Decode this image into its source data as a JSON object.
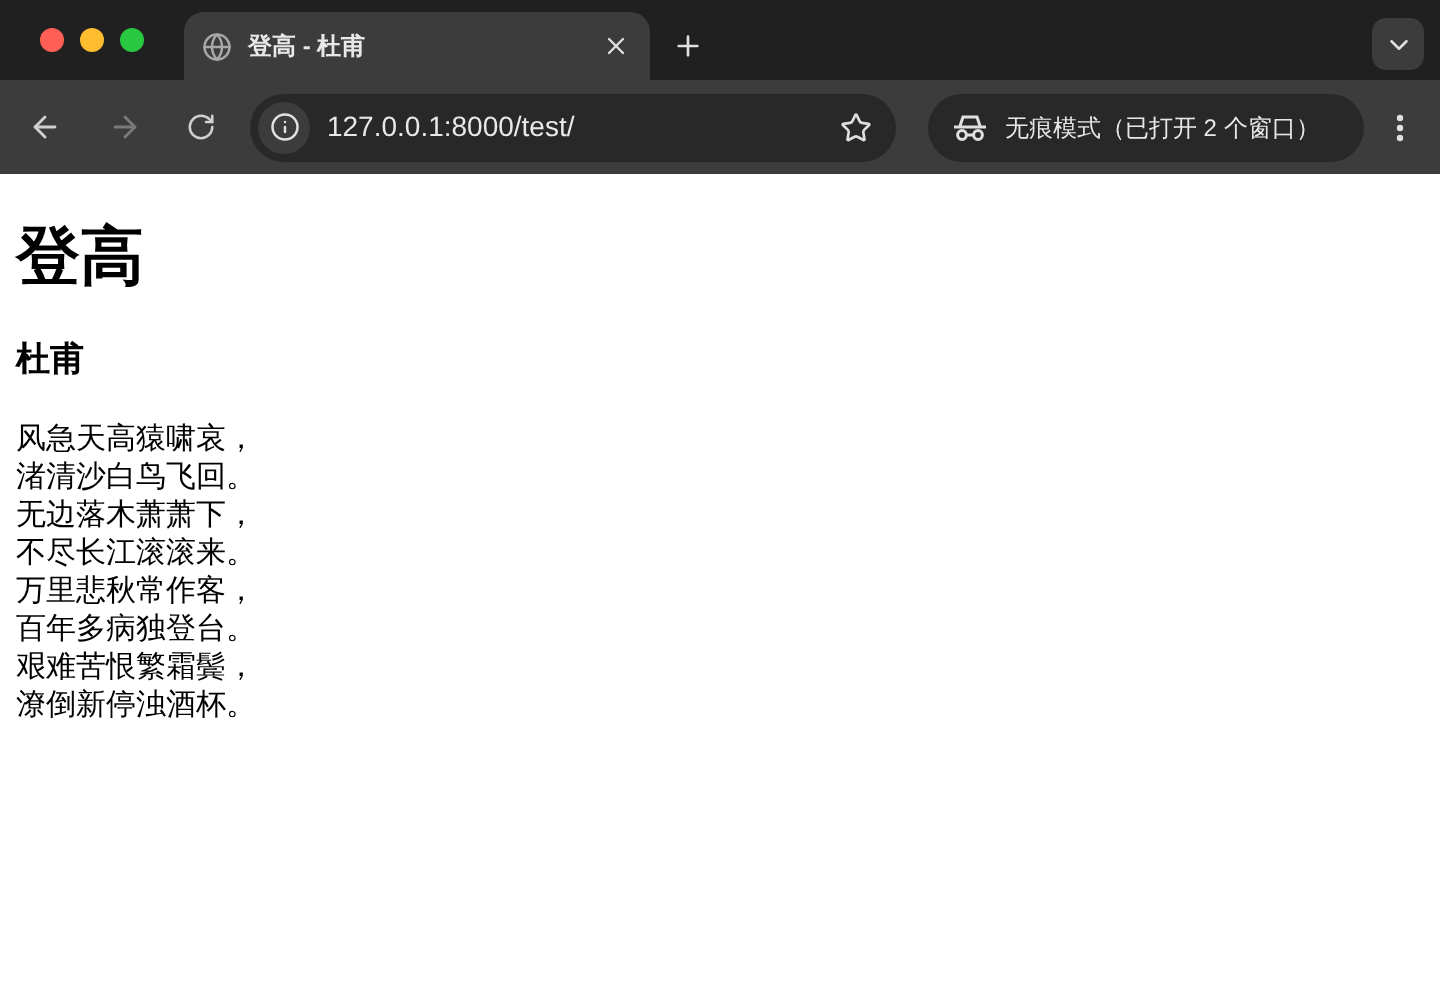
{
  "tabs": [
    {
      "title": "登高 - 杜甫",
      "selected": true
    }
  ],
  "toolbar": {
    "back_disabled": false,
    "forward_disabled": true,
    "url": "127.0.0.1:8000/test/",
    "bookmarked": false,
    "incognito_label": "无痕模式（已打开 2 个窗口）"
  },
  "page": {
    "title": "登高",
    "author": "杜甫",
    "lines": [
      "风急天高猿啸哀，",
      "渚清沙白鸟飞回。",
      "无边落木萧萧下，",
      "不尽长江滚滚来。",
      "万里悲秋常作客，",
      "百年多病独登台。",
      "艰难苦恨繁霜鬓，",
      "潦倒新停浊酒杯。"
    ]
  }
}
